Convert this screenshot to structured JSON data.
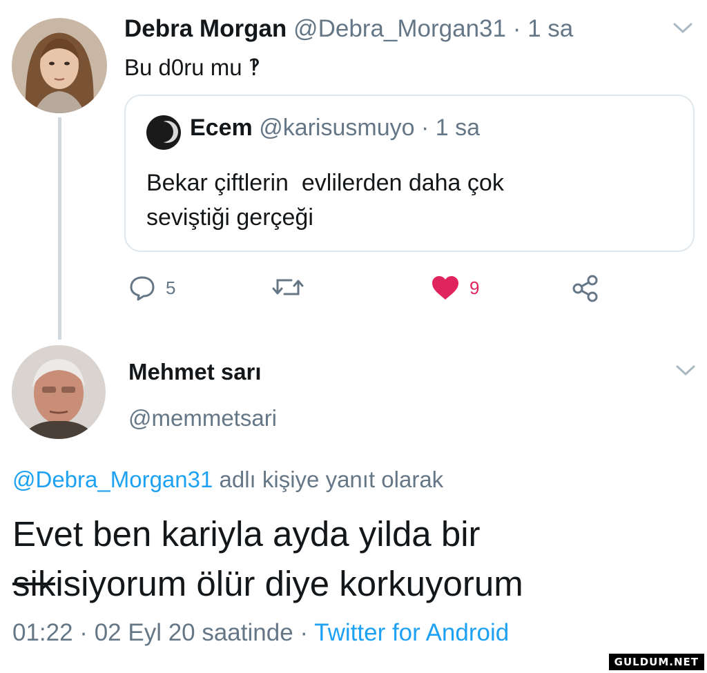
{
  "tweet1": {
    "author_name": "Debra Morgan",
    "author_handle": "@Debra_Morgan31",
    "time": "· 1 sa",
    "text": "Bu d0ru mu ‽",
    "quoted": {
      "author_name": "Ecem",
      "author_handle": "@karisusmuyo",
      "time": "· 1 sa",
      "text_line1": "Bekar çiftlerin  evlilerden daha çok",
      "text_line2": "seviştiği gerçeği"
    },
    "actions": {
      "reply_count": "5",
      "like_count": "9",
      "like_color": "#e0245e"
    }
  },
  "tweet2": {
    "author_name": "Mehmet sarı",
    "author_handle": "@memmetsari",
    "reply_to_mention": "@Debra_Morgan31",
    "reply_to_suffix": "adlı kişiye yanıt olarak",
    "text_line1": "Evet ben kariyla ayda yilda bir",
    "text_line2_censored": "sik",
    "text_line2_rest": "isiyorum ölür diye korkuyorum",
    "timestamp": "01:22 · 02 Eyl 20 saatinde ·",
    "source": "Twitter for Android"
  },
  "watermark": "GULDUM.NET",
  "colors": {
    "link": "#1da1f2",
    "muted": "#657786",
    "border": "#e1e8ed"
  },
  "icons": [
    "caret-down-icon",
    "reply-icon",
    "retweet-icon",
    "heart-icon",
    "share-icon"
  ]
}
